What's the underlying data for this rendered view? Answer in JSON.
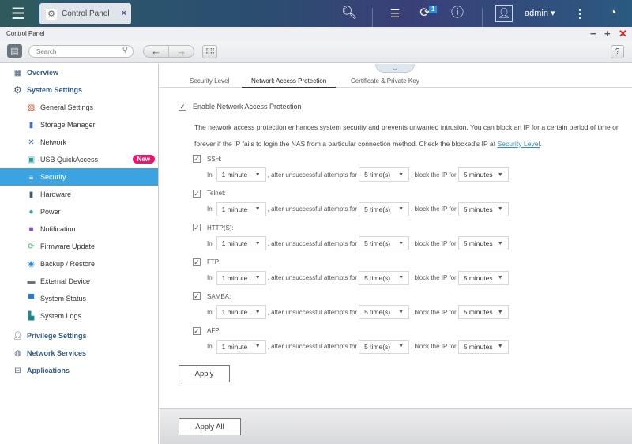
{
  "topbar": {
    "menu_icon": "hamburger-icon",
    "app_tab": {
      "icon": "gear-icon",
      "label": "Control Panel",
      "close": "×"
    },
    "icons": {
      "search": "search-icon",
      "tasks": "background-tasks-icon",
      "notifications": "notification-bell-icon",
      "info": "info-icon",
      "more": "more-vertical-icon",
      "dashboard": "dashboard-gauge-icon"
    },
    "notification_count": "1",
    "user": "admin ▾"
  },
  "window": {
    "title": "Control Panel",
    "minimize": "−",
    "maximize": "+",
    "close": "✕"
  },
  "toolbar": {
    "search_placeholder": "Search",
    "back": "←",
    "forward": "→",
    "help": "?"
  },
  "sidebar": {
    "items": [
      {
        "label": "Overview",
        "level": "top",
        "icon": "overview-icon"
      },
      {
        "label": "System Settings",
        "level": "top",
        "icon": "gear-icon"
      },
      {
        "label": "General Settings",
        "level": "sub",
        "icon": "general-settings-icon"
      },
      {
        "label": "Storage Manager",
        "level": "sub",
        "icon": "storage-icon"
      },
      {
        "label": "Network",
        "level": "sub",
        "icon": "network-icon"
      },
      {
        "label": "USB QuickAccess",
        "level": "sub",
        "icon": "usb-icon",
        "badge": "New"
      },
      {
        "label": "Security",
        "level": "sub",
        "icon": "lock-icon",
        "active": true
      },
      {
        "label": "Hardware",
        "level": "sub",
        "icon": "hardware-icon"
      },
      {
        "label": "Power",
        "level": "sub",
        "icon": "power-bulb-icon"
      },
      {
        "label": "Notification",
        "level": "sub",
        "icon": "notification-icon"
      },
      {
        "label": "Firmware Update",
        "level": "sub",
        "icon": "firmware-icon"
      },
      {
        "label": "Backup / Restore",
        "level": "sub",
        "icon": "backup-icon"
      },
      {
        "label": "External Device",
        "level": "sub",
        "icon": "external-device-icon"
      },
      {
        "label": "System Status",
        "level": "sub",
        "icon": "monitor-icon"
      },
      {
        "label": "System Logs",
        "level": "sub",
        "icon": "logs-icon"
      },
      {
        "label": "Privilege Settings",
        "level": "top",
        "icon": "user-icon"
      },
      {
        "label": "Network Services",
        "level": "top",
        "icon": "globe-icon"
      },
      {
        "label": "Applications",
        "level": "top",
        "icon": "applications-icon"
      }
    ]
  },
  "main": {
    "tabs": [
      {
        "label": "Security Level"
      },
      {
        "label": "Network Access Protection",
        "active": true
      },
      {
        "label": "Certificate & Private Key"
      }
    ],
    "enable_label": "Enable Network Access Protection",
    "enable_checked": true,
    "description_1": "The network access protection enhances system security and prevents unwanted intrusion. You can block an IP for a certain period of time or forever if the IP fails to login the NAS from a particular connection method. Check the blocked's IP at ",
    "description_link": "Security Level",
    "description_end": ".",
    "rule_text": {
      "in": "In",
      "after": ", after unsuccessful attempts for",
      "block": ", block the IP for"
    },
    "protocols": [
      {
        "name": "SSH:",
        "checked": true,
        "period": "1 minute",
        "attempts": "5 time(s)",
        "block": "5 minutes"
      },
      {
        "name": "Telnet:",
        "checked": true,
        "period": "1 minute",
        "attempts": "5 time(s)",
        "block": "5 minutes"
      },
      {
        "name": "HTTP(S):",
        "checked": true,
        "period": "1 minute",
        "attempts": "5 time(s)",
        "block": "5 minutes"
      },
      {
        "name": "FTP:",
        "checked": true,
        "period": "1 minute",
        "attempts": "5 time(s)",
        "block": "5 minutes"
      },
      {
        "name": "SAMBA:",
        "checked": true,
        "period": "1 minute",
        "attempts": "5 time(s)",
        "block": "5 minutes"
      },
      {
        "name": "AFP:",
        "checked": true,
        "period": "1 minute",
        "attempts": "5 time(s)",
        "block": "5 minutes"
      }
    ],
    "apply_label": "Apply"
  },
  "footer": {
    "apply_all_label": "Apply All"
  },
  "colors": {
    "accent": "#3ba4e0",
    "badge": "#e8196a",
    "link": "#2a8fd0",
    "nav_text": "#2f5a8a"
  }
}
